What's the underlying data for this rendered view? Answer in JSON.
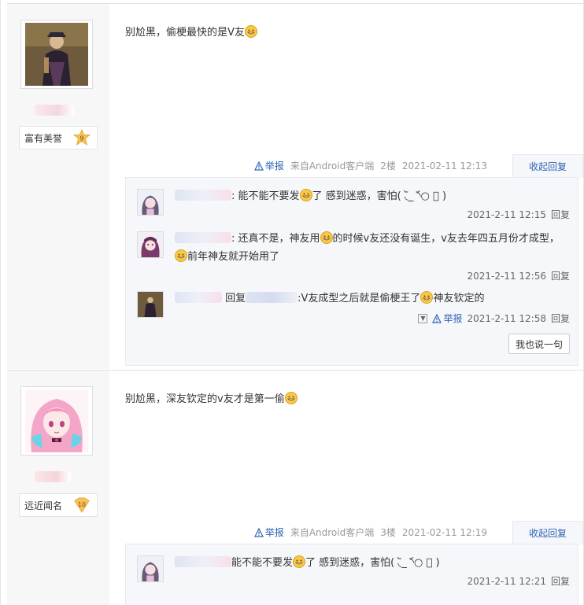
{
  "posts": [
    {
      "badge_label": "富有美誉",
      "badge_level": "9",
      "content": "别尬黑，偷梗最快的是V友",
      "report_label": "举报",
      "source": "来自Android客户端",
      "floor": "2楼",
      "time": "2021-02-11 12:13",
      "fold_label": "收起回复",
      "replies": [
        {
          "text_a": ": 能不能不要发",
          "text_b": "了 感到迷惑，害怕( ◟᷅_ ◝᷄○ ⃘ )",
          "time": "2021-2-11 12:15",
          "reply_label": "回复"
        },
        {
          "text_a": ": 还真不是，神友用",
          "text_b": "的时候v友还没有诞生，v友去年四五月份才成型，",
          "text_c": "前年神友就开始用了",
          "time": "2021-2-11 12:56",
          "reply_label": "回复"
        },
        {
          "prefix": "回复",
          "text_a": ":V友成型之后就是偷梗王了",
          "text_b": "神友钦定的",
          "report_label": "举报",
          "time": "2021-2-11 12:58",
          "reply_label": "回复"
        }
      ],
      "speak_label": "我也说一句"
    },
    {
      "badge_label": "远近闻名",
      "badge_level": "10",
      "content": "别尬黑，深友钦定的v友才是第一偷",
      "report_label": "举报",
      "source": "来自Android客户端",
      "floor": "3楼",
      "time": "2021-02-11 12:19",
      "fold_label": "收起回复",
      "replies": [
        {
          "text_a": "能不能不要发",
          "text_b": "了 感到迷惑，害怕( ◟᷅_ ◝᷄○ ⃘ )",
          "time": "2021-2-11 12:21",
          "reply_label": "回复"
        }
      ]
    }
  ],
  "colors": {
    "link": "#2d64b3",
    "sidebar": "#f7f7f7",
    "lzl_bg": "#f6f7fb"
  },
  "icons": [
    "warning-icon",
    "grin-emoji-icon",
    "level-badge-icon",
    "dropdown-icon"
  ]
}
